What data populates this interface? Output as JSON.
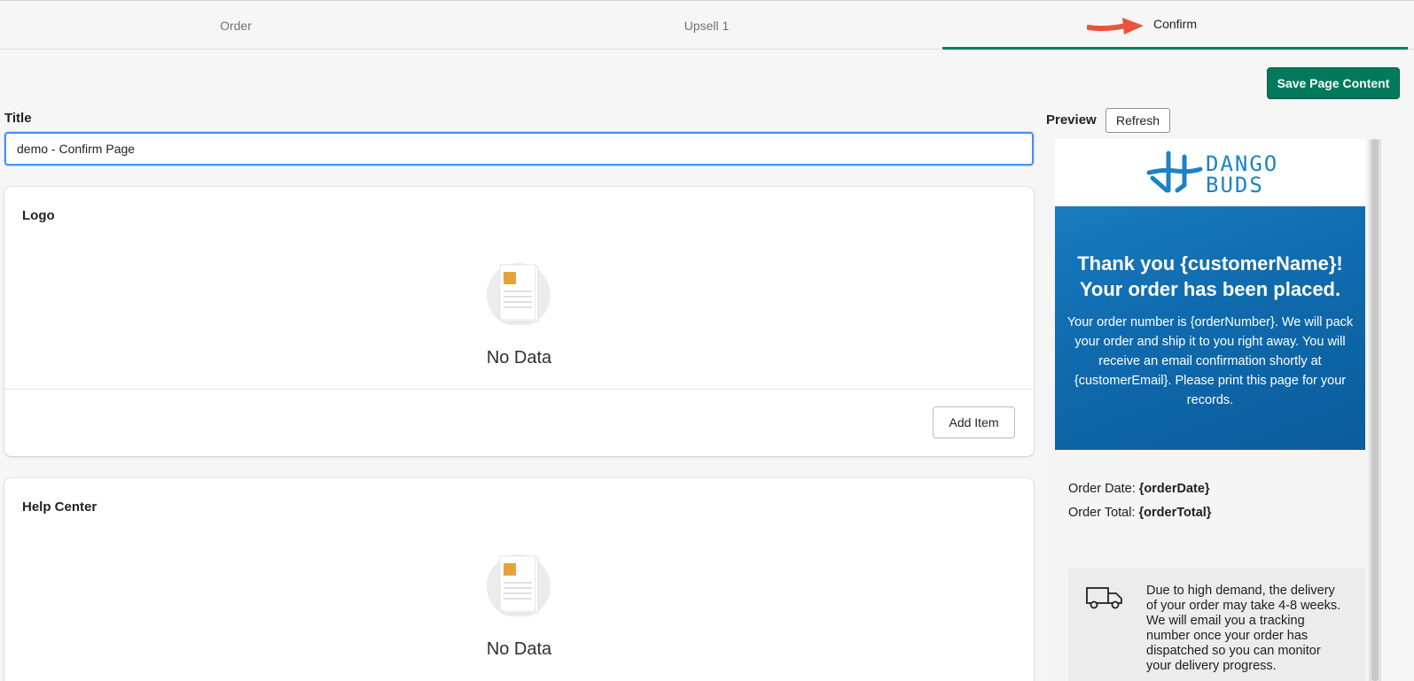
{
  "tabs": [
    {
      "label": "Order"
    },
    {
      "label": "Upsell 1"
    },
    {
      "label": "Confirm"
    }
  ],
  "toolbar": {
    "save_label": "Save Page Content"
  },
  "title_field": {
    "label": "Title",
    "value": "demo - Confirm Page"
  },
  "cards": {
    "logo": {
      "title": "Logo",
      "empty_text": "No Data",
      "add_label": "Add Item"
    },
    "help": {
      "title": "Help Center",
      "empty_text": "No Data"
    }
  },
  "preview": {
    "label": "Preview",
    "refresh_label": "Refresh",
    "brand": {
      "line1": "DANGO",
      "line2": "BUDS"
    },
    "hero_title_line1": "Thank you {customerName}!",
    "hero_title_line2": "Your order has been placed.",
    "hero_text": "Your order number is {orderNumber}. We will pack your order and ship it to you right away. You will receive an email confirmation shortly at {customerEmail}. Please print this page for your records.",
    "order_date_label": "Order Date: ",
    "order_date_value": "{orderDate}",
    "order_total_label": "Order Total: ",
    "order_total_value": "{orderTotal}",
    "notice_text": "Due to high demand, the delivery of your order may take 4-8 weeks. We will email you a tracking number once your order has dispatched so you can monitor your delivery progress."
  },
  "colors": {
    "accent": "#008060",
    "save_bg": "#007a5a",
    "focus": "#458fff",
    "brand_blue": "#1b82c5"
  }
}
